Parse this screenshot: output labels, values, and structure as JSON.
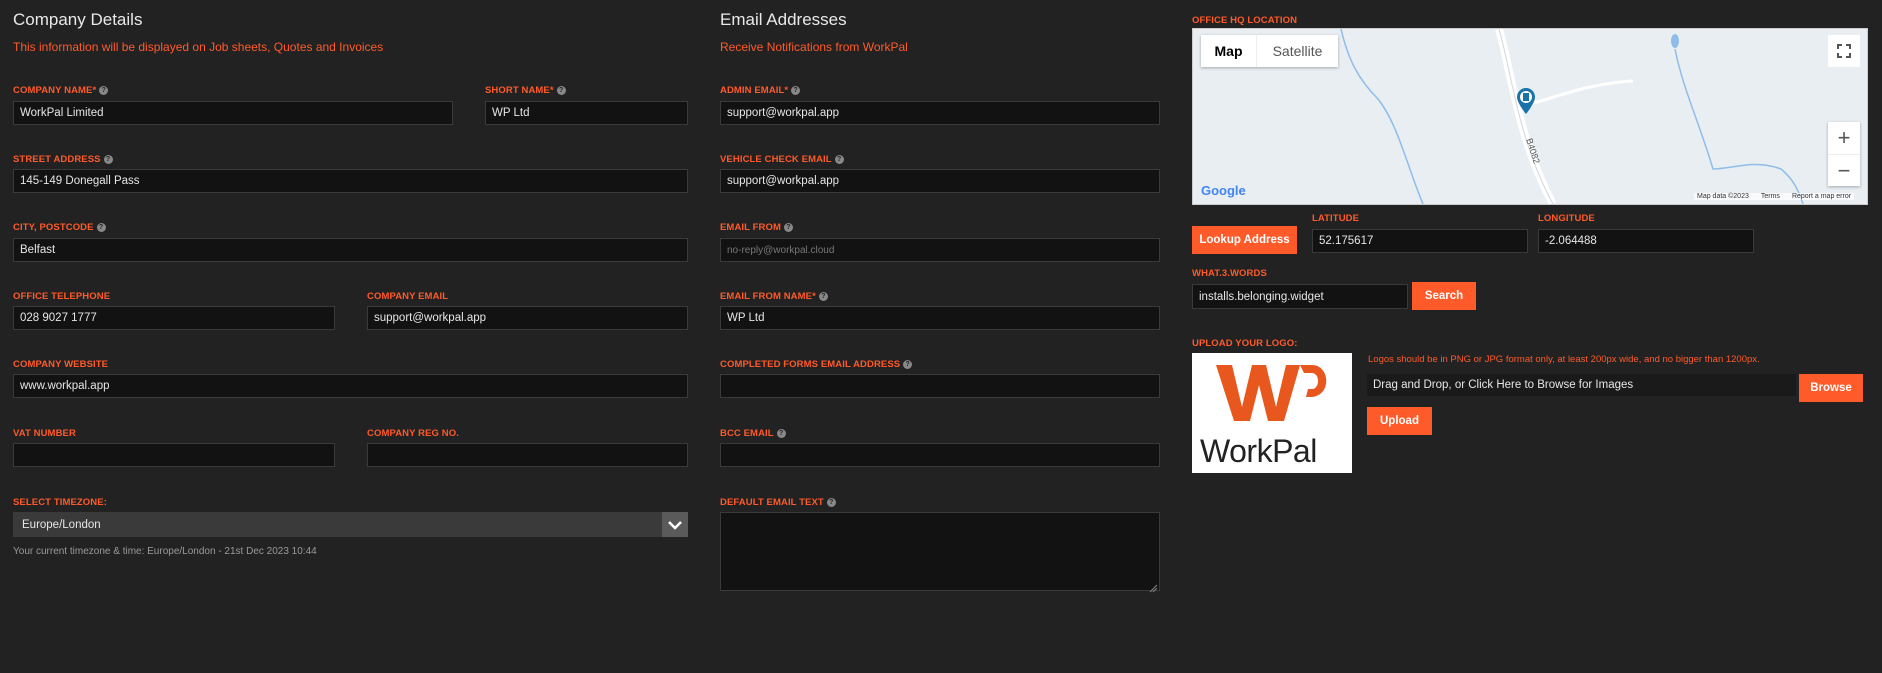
{
  "company": {
    "title": "Company Details",
    "subtitle": "This information will be displayed on Job sheets, Quotes and Invoices",
    "company_name_label": "COMPANY NAME*",
    "company_name_value": "WorkPal Limited",
    "short_name_label": "SHORT NAME*",
    "short_name_value": "WP Ltd",
    "street_label": "STREET ADDRESS",
    "street_value": "145-149 Donegall Pass",
    "city_label": "CITY, POSTCODE",
    "city_value": "Belfast",
    "phone_label": "OFFICE TELEPHONE",
    "phone_value": "028 9027 1777",
    "email_label": "COMPANY EMAIL",
    "email_value": "support@workpal.app",
    "website_label": "COMPANY WEBSITE",
    "website_value": "www.workpal.app",
    "vat_label": "VAT NUMBER",
    "vat_value": "",
    "reg_label": "COMPANY REG NO.",
    "reg_value": "",
    "timezone_label": "SELECT TIMEZONE:",
    "timezone_value": "Europe/London",
    "timezone_note": "Your current timezone & time: Europe/London - 21st Dec 2023 10:44"
  },
  "emails": {
    "title": "Email Addresses",
    "subtitle": "Receive Notifications from WorkPal",
    "admin_label": "ADMIN EMAIL*",
    "admin_value": "support@workpal.app",
    "vehicle_label": "VEHICLE CHECK EMAIL",
    "vehicle_value": "support@workpal.app",
    "from_label": "EMAIL FROM",
    "from_placeholder": "no-reply@workpal.cloud",
    "from_name_label": "EMAIL FROM NAME*",
    "from_name_value": "WP Ltd",
    "completed_label": "COMPLETED FORMS EMAIL ADDRESS",
    "completed_value": "",
    "bcc_label": "BCC EMAIL",
    "bcc_value": "",
    "default_text_label": "DEFAULT EMAIL TEXT",
    "default_text_value": ""
  },
  "location": {
    "title": "OFFICE HQ LOCATION",
    "map_tab": "Map",
    "satellite_tab": "Satellite",
    "road_label": "B4082",
    "google": "Google",
    "map_data": "Map data ©2023",
    "terms": "Terms",
    "report": "Report a map error",
    "zoom_in": "+",
    "zoom_out": "−",
    "lookup_button": "Lookup Address",
    "latitude_label": "LATITUDE",
    "latitude_value": "52.175617",
    "longitude_label": "LONGITUDE",
    "longitude_value": "-2.064488",
    "w3w_label": "WHAT.3.WORDS",
    "w3w_value": "installs.belonging.widget",
    "search_button": "Search"
  },
  "logo": {
    "label": "UPLOAD YOUR LOGO:",
    "hint": "Logos should be in PNG or JPG format only, at least 200px wide, and no bigger than 1200px.",
    "drop_text": "Drag and Drop, or Click Here to Browse for Images",
    "browse_button": "Browse",
    "upload_button": "Upload",
    "logo_text": "WorkPal"
  },
  "colors": {
    "accent": "#ff5a2a",
    "background": "#222222",
    "input_bg": "#121212"
  }
}
